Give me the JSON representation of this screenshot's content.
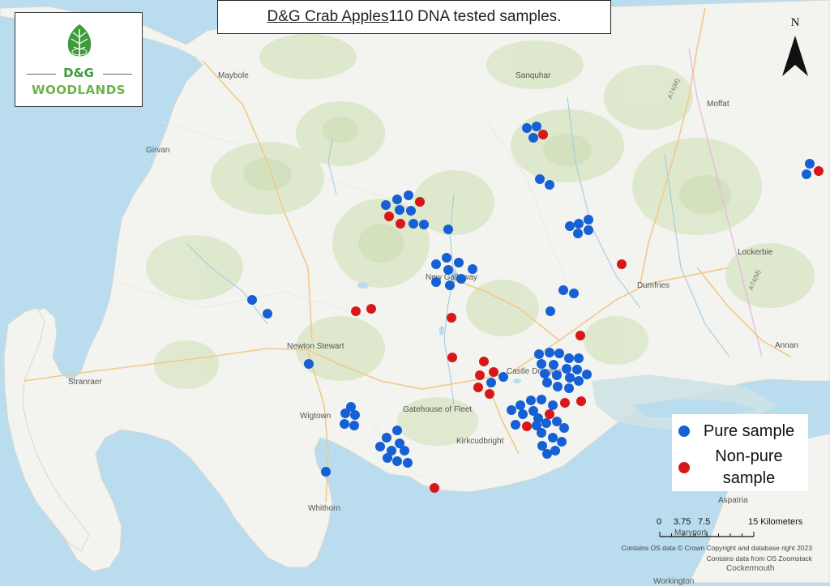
{
  "title": {
    "underlined": "D&G Crab Apples ",
    "rest": "110 DNA tested samples."
  },
  "logo": {
    "line1": "D&G",
    "line2": "WOODLANDS",
    "icon": "tree-leaf-icon",
    "color": "#3e9a3c"
  },
  "north_arrow": {
    "label": "N",
    "icon": "north-arrow-icon"
  },
  "places": {
    "maybole": "Maybole",
    "sanquhar": "Sanquhar",
    "moffat": "Moffat",
    "girvan": "Girvan",
    "lockerbie": "Lockerbie",
    "new_galloway": "New Galloway",
    "dumfries": "Dumfries",
    "newton_stewart": "Newton Stewart",
    "annan": "Annan",
    "stranraer": "Stranraer",
    "castle_douglas": "Castle Douglas",
    "gatehouse": "Gatehouse of Fleet",
    "wigtown": "Wigtown",
    "kirkcudbright": "Kirkcudbright",
    "whithorn": "Whithorn",
    "aspatria": "Aspatria",
    "maryport": "Maryport",
    "cockermouth": "Cockermouth",
    "workington": "Workington"
  },
  "roads": {
    "a74m_north": "A74(M)",
    "a74m_south": "A74(M)"
  },
  "legend": {
    "pure_label": "Pure sample",
    "nonpure_label_line1": "Non-pure",
    "nonpure_label_line2": "sample",
    "pure_color": "#1560d4",
    "nonpure_color": "#d81818"
  },
  "scale": {
    "labels": [
      "0",
      "3.75",
      "7.5",
      "15 Kilometers"
    ],
    "ticks_km": [
      0,
      3.75,
      7.5,
      15
    ]
  },
  "credits": {
    "line1": "Contains OS data © Crown Copyright and database right 2023",
    "line2": "Contains data from OS Zoomstack"
  },
  "colors": {
    "sea": "#b9dcee",
    "land": "#f3f3ef",
    "woodland": "#dfe8cf",
    "roads": "#f6d6a0"
  }
}
